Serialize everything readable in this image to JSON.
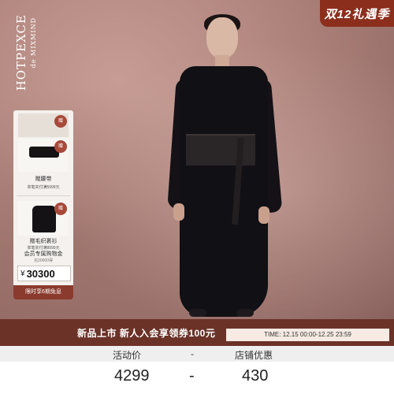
{
  "brand": {
    "name": "HOTPEXCE",
    "sub": "de MIXMIND"
  },
  "badge": {
    "label": "双12礼遇季"
  },
  "gifts": {
    "belt_label": "赠腰带",
    "belt_condition": "单笔实付满5999元",
    "coat_label": "赠毛织裹衫",
    "coat_condition": "单笔实付满8999元",
    "gift_tag": "赠"
  },
  "member": {
    "title": "会员专属购物金",
    "subtitle": "充30000得",
    "currency": "¥",
    "amount": "30300",
    "installment": "限时享6期免息"
  },
  "promo": {
    "text": "新品上市 新人入会享领券100元",
    "time": "TIME: 12.15 00:00-12.25 23:59"
  },
  "price_table": {
    "activity_label": "活动价",
    "dash": "-",
    "store_label": "店铺优惠",
    "activity_price": "4299",
    "store_discount": "430"
  },
  "colors": {
    "accent": "#8b2e1c",
    "promo_bg": "#6b3228",
    "panel_bg": "#f4f1ee"
  }
}
